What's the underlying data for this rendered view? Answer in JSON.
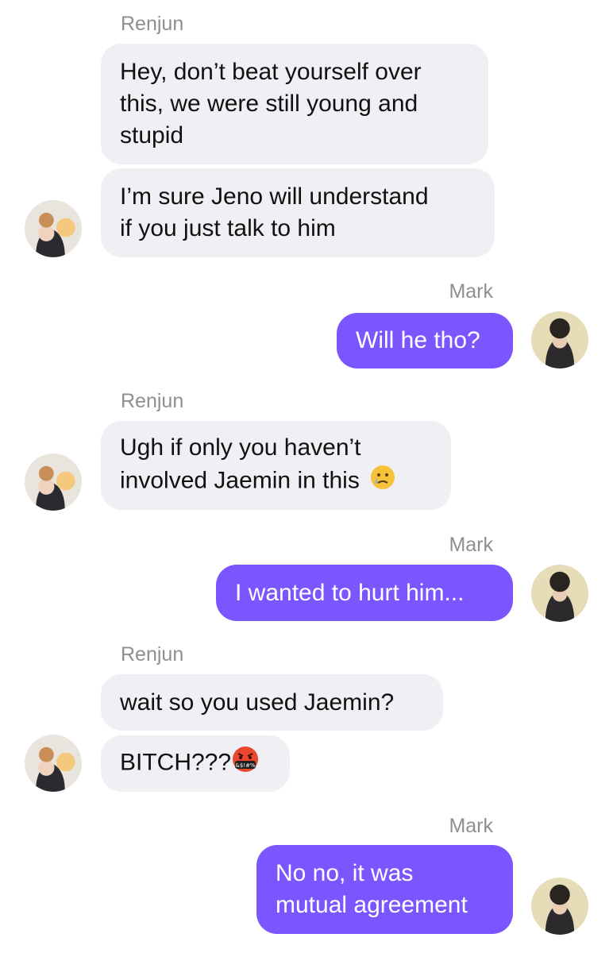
{
  "thread": [
    {
      "type": "name",
      "text": "Renjun"
    },
    {
      "type": "in",
      "lines": [
        "Hey, don’t beat yourself over",
        "this, we were still young and",
        "stupid"
      ]
    },
    {
      "type": "in",
      "lines": [
        "I’m sure Jeno will understand",
        "if you just talk to him"
      ]
    },
    {
      "type": "name",
      "text": "Mark"
    },
    {
      "type": "out",
      "text": "Will he tho?"
    },
    {
      "type": "name",
      "text": "Renjun"
    },
    {
      "type": "in",
      "lines": [
        "Ugh if only you haven’t",
        "involved Jaemin in this"
      ],
      "emoji": "crying-face"
    },
    {
      "type": "name",
      "text": "Mark"
    },
    {
      "type": "out",
      "text": "I wanted to hurt him..."
    },
    {
      "type": "name",
      "text": "Renjun"
    },
    {
      "type": "in",
      "lines": [
        "wait so you used Jaemin?"
      ]
    },
    {
      "type": "in",
      "text": "BITCH???",
      "emoji": "cursing-face"
    },
    {
      "type": "name",
      "text": "Mark"
    },
    {
      "type": "out",
      "lines": [
        "No no, it was",
        "mutual agreement"
      ]
    }
  ],
  "senders": {
    "left": "Renjun",
    "right": "Mark"
  },
  "colors": {
    "incoming_bubble": "#efeff4",
    "outgoing_bubble": "#7b56ff",
    "name_text": "#8e8e93"
  },
  "emoji_text": {
    "cursing": "&$!#%"
  }
}
